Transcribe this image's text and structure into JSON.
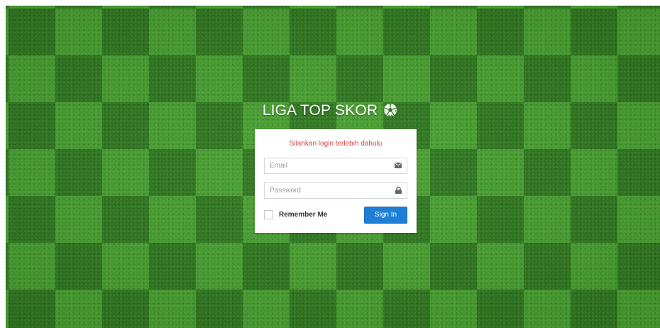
{
  "brand": {
    "title": "LIGA TOP SKOR",
    "icon": "soccer-ball-icon"
  },
  "login": {
    "message": "Silahkan login terlebih dahulu",
    "email": {
      "placeholder": "Email",
      "value": "",
      "icon": "envelope-icon"
    },
    "password": {
      "placeholder": "Password",
      "value": "",
      "icon": "lock-icon"
    },
    "remember_label": "Remember Me",
    "remember_checked": false,
    "signin_label": "Sign In"
  },
  "colors": {
    "grass_light": "#48a22f",
    "grass_dark": "#2f7a1f",
    "message": "#d04a4a",
    "button": "#1f7fd6"
  }
}
